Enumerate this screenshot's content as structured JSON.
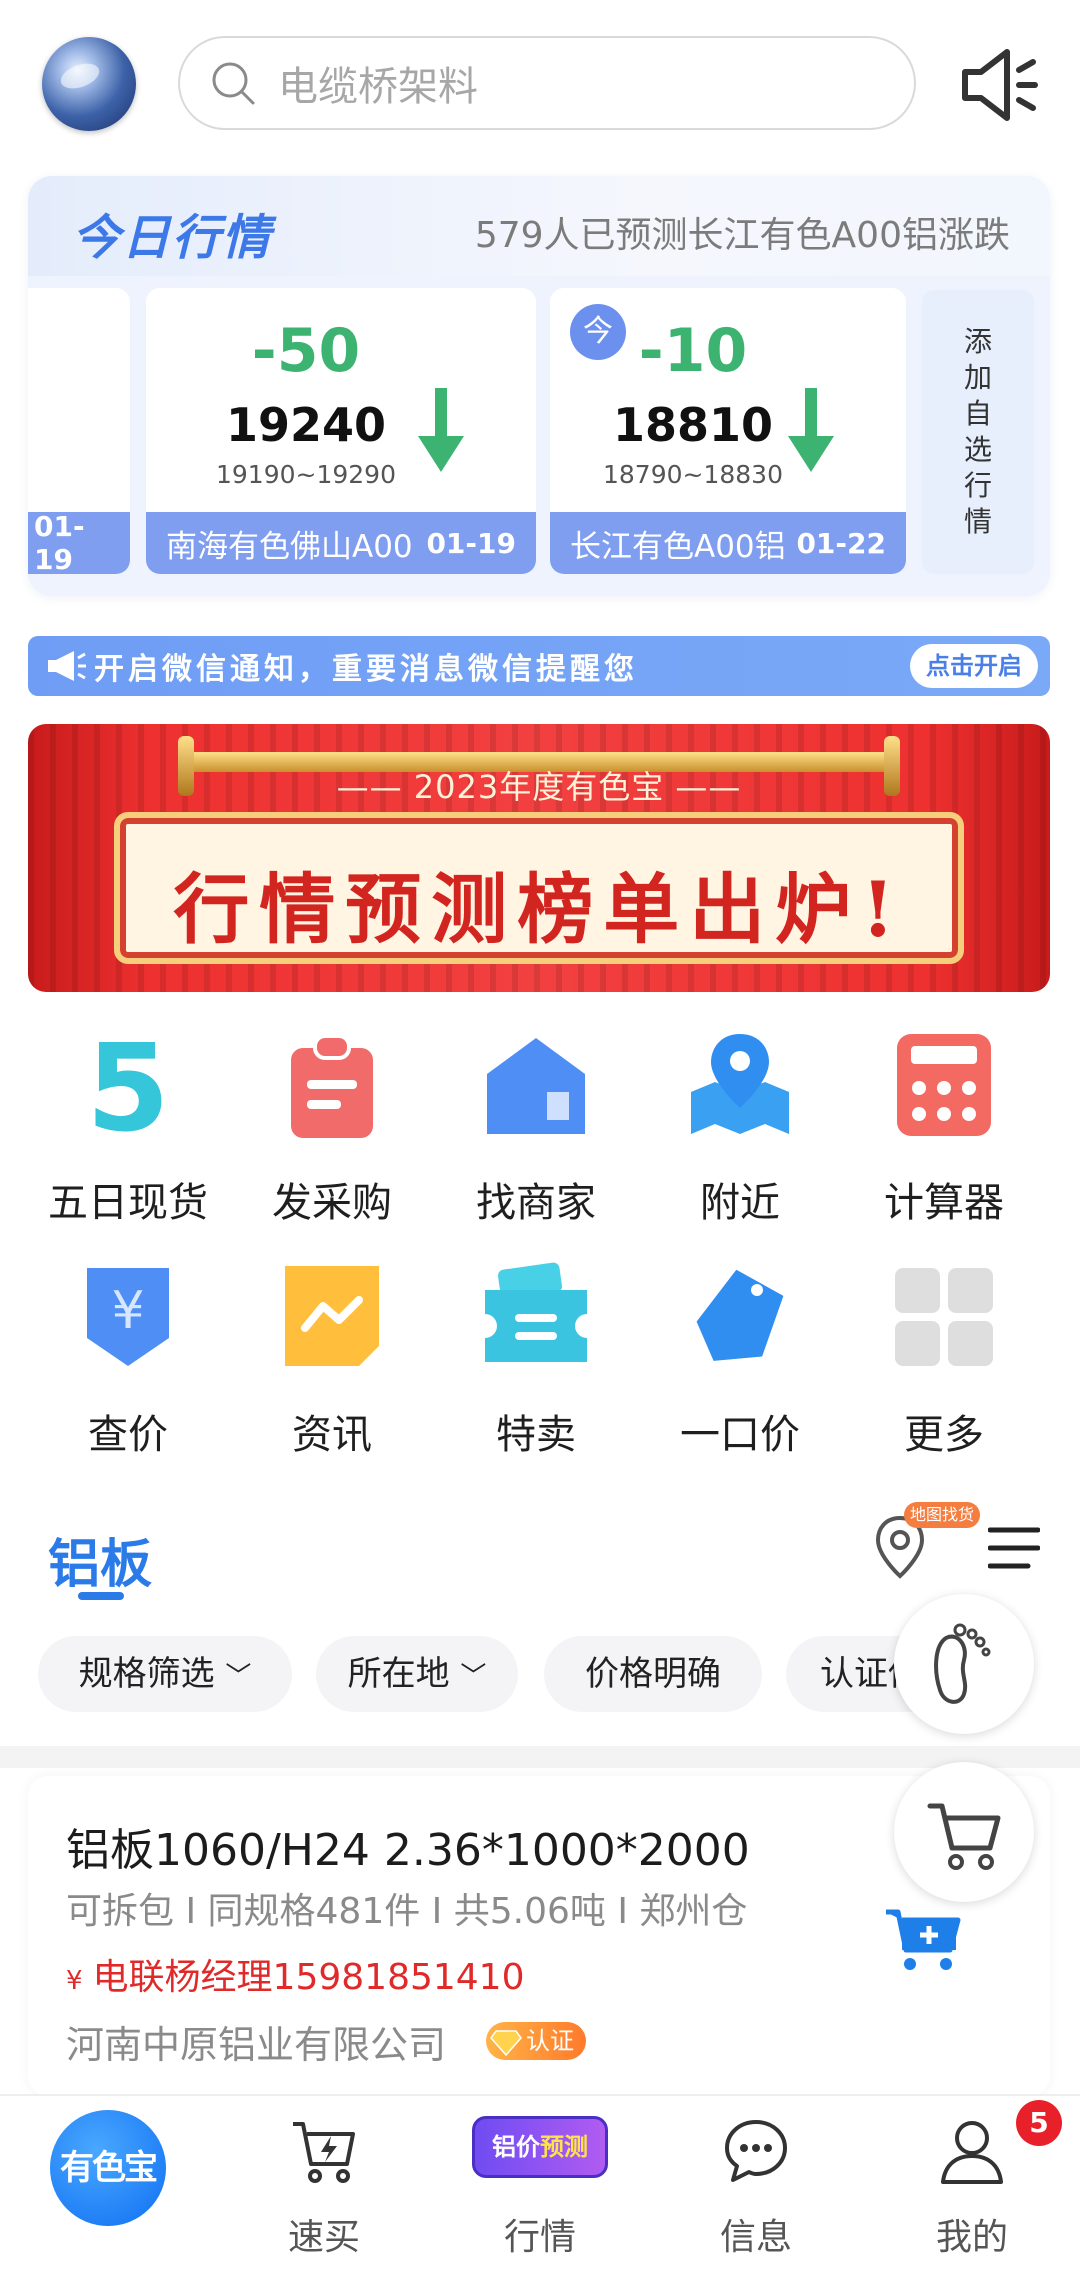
{
  "search": {
    "placeholder": "电缆桥架料"
  },
  "market": {
    "title": "今日行情",
    "subtitle": "579人已预测长江有色A00铝涨跌",
    "partial_date": "01-19",
    "quotes": [
      {
        "change": "-50",
        "price": "19240",
        "range": "19190~19290",
        "name": "南海有色佛山A00",
        "date": "01-19",
        "today": ""
      },
      {
        "change": "-10",
        "price": "18810",
        "range": "18790~18830",
        "name": "长江有色A00铝",
        "date": "01-22",
        "today": "今"
      }
    ],
    "add_watch": "添加自选行情"
  },
  "notice": {
    "text": "开启微信通知，重要消息微信提醒您",
    "button": "点击开启"
  },
  "banner": {
    "year": "—— 2023年度有色宝 ——",
    "headline": "行情预测榜单出炉!"
  },
  "grid": [
    {
      "label": "五日现货",
      "icon": "five-day-icon"
    },
    {
      "label": "发采购",
      "icon": "clipboard-icon"
    },
    {
      "label": "找商家",
      "icon": "store-icon"
    },
    {
      "label": "附近",
      "icon": "map-location-icon"
    },
    {
      "label": "计算器",
      "icon": "calculator-icon"
    },
    {
      "label": "查价",
      "icon": "yen-shield-icon"
    },
    {
      "label": "资讯",
      "icon": "news-chart-icon"
    },
    {
      "label": "特卖",
      "icon": "ticket-icon"
    },
    {
      "label": "一口价",
      "icon": "price-tag-icon"
    },
    {
      "label": "更多",
      "icon": "more-grid-icon"
    }
  ],
  "section": {
    "title": "铝板",
    "map_tag": "地图找货"
  },
  "filters": [
    "规格筛选",
    "所在地",
    "价格明确",
    "认证供应商"
  ],
  "product": {
    "title": "铝板1060/H24 2.36*1000*2000",
    "meta": "可拆包 I 同规格481件 I 共5.06吨 I 郑州仓",
    "yen": "¥",
    "contact": "电联杨经理15981851410",
    "company": "河南中原铝业有限公司",
    "cert": "认证"
  },
  "nav": {
    "home": "有色宝",
    "items": [
      "速买",
      "行情",
      "信息",
      "我的"
    ],
    "forecast_a": "铝价",
    "forecast_b": "预测",
    "unread": "5"
  },
  "colors": {
    "accent": "#2a7ae8",
    "down": "#3cb371",
    "red": "#e02a2a"
  }
}
